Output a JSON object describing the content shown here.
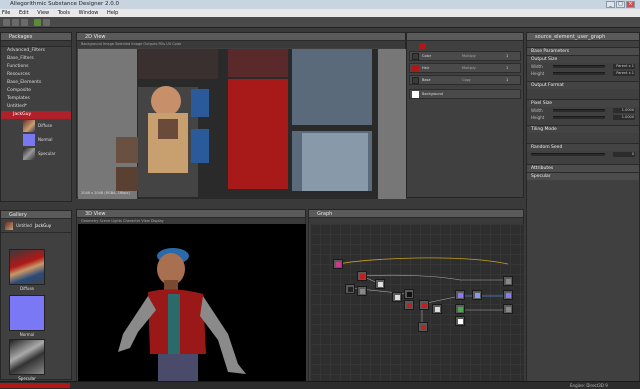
{
  "window": {
    "title": "Allegorithmic Substance Designer 2.0.0"
  },
  "menu": [
    "File",
    "Edit",
    "View",
    "Tools",
    "Window",
    "Help"
  ],
  "explorer": {
    "title": "Packages",
    "items": [
      "Advanced_Filters",
      "Base_Filters",
      "Functions",
      "Resources",
      "Base_Elements",
      "Composite",
      "Templates",
      "Untitled*",
      "JackGuy"
    ],
    "outputs": [
      "Diffuse",
      "Normal",
      "Specular"
    ]
  },
  "gallery": {
    "title": "Gallery",
    "header_label": "Untitled",
    "header_value": "JackGuy",
    "thumbs": [
      "Diffuse",
      "Normal",
      "Specular"
    ]
  },
  "view2d": {
    "title": "2D View",
    "toolbar": "Background Image   Selected Image   Outputs   Fills   UV Color",
    "status": "2048 x 2048 (RGBA, 16bpc)"
  },
  "layers": {
    "rows": [
      {
        "name": "Color",
        "mode": "Multiply",
        "opacity": "1",
        "color": "#3a3a3a"
      },
      {
        "name": "Hair",
        "mode": "Multiply",
        "opacity": "1",
        "color": "#b01818"
      },
      {
        "name": "Base",
        "mode": "Copy",
        "opacity": "1",
        "color": "#3a3a3a"
      }
    ],
    "background_label": "Background",
    "background_color": "#ffffff"
  },
  "params": {
    "title": "source_element_user_graph",
    "base_section": "Base Parameters",
    "output_size": {
      "label": "Output Size",
      "rows": [
        {
          "name": "Width",
          "value": "Parent x 1"
        },
        {
          "name": "Height",
          "value": "Parent x 1"
        }
      ]
    },
    "output_format": "Output Format",
    "pixel_size": {
      "label": "Pixel Size",
      "rows": [
        {
          "name": "Width",
          "value": "1.0000"
        },
        {
          "name": "Height",
          "value": "1.0000"
        }
      ]
    },
    "tiling_mode": "Tiling Mode",
    "random_seed": {
      "label": "Random Seed",
      "value": "0"
    },
    "attributes": "Attributes",
    "specular": "Specular"
  },
  "view3d": {
    "title": "3D View",
    "toolbar": "Geometry   Scene   Lights   Character   View   Display"
  },
  "graph": {
    "title": "Graph"
  },
  "status": {
    "engine": "Engine: Direct3D 9"
  }
}
